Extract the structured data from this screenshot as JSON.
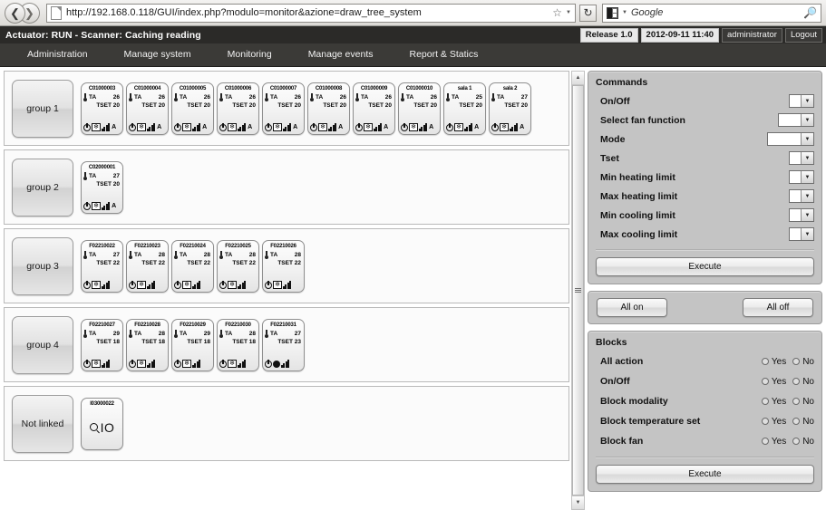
{
  "browser": {
    "back_icon": "arrow-left-icon",
    "forward_icon": "arrow-right-icon",
    "url": "http://192.168.0.118/GUI/index.php?modulo=monitor&azione=draw_tree_system",
    "bookmark_icon": "star-icon",
    "reload_icon": "reload-icon",
    "search_engine": "Google",
    "search_icon": "magnifier-icon"
  },
  "app_header": {
    "status": "Actuator: RUN - Scanner: Caching reading",
    "release": "Release 1.0",
    "datetime": "2012-09-11 11:40",
    "user": "administrator",
    "logout": "Logout"
  },
  "nav": {
    "items": [
      {
        "label": "Administration"
      },
      {
        "label": "Manage system"
      },
      {
        "label": "Monitoring"
      },
      {
        "label": "Manage events"
      },
      {
        "label": "Report & Statics"
      }
    ]
  },
  "tree": {
    "groups": [
      {
        "name": "group 1",
        "devices": [
          {
            "code": "C01000003",
            "ta_label": "TA",
            "ta": "26",
            "tset_label": "TSET",
            "tset": "20",
            "mode_icon": "snowflake-box-icon",
            "fan": "A"
          },
          {
            "code": "C01000004",
            "ta_label": "TA",
            "ta": "26",
            "tset_label": "TSET",
            "tset": "20",
            "mode_icon": "snowflake-box-icon",
            "fan": "A"
          },
          {
            "code": "C01000005",
            "ta_label": "TA",
            "ta": "26",
            "tset_label": "TSET",
            "tset": "20",
            "mode_icon": "snowflake-box-icon",
            "fan": "A"
          },
          {
            "code": "C01000006",
            "ta_label": "TA",
            "ta": "26",
            "tset_label": "TSET",
            "tset": "20",
            "mode_icon": "snowflake-box-icon",
            "fan": "A"
          },
          {
            "code": "C01000007",
            "ta_label": "TA",
            "ta": "26",
            "tset_label": "TSET",
            "tset": "20",
            "mode_icon": "snowflake-box-icon",
            "fan": "A"
          },
          {
            "code": "C01000008",
            "ta_label": "TA",
            "ta": "26",
            "tset_label": "TSET",
            "tset": "20",
            "mode_icon": "snowflake-box-icon",
            "fan": "A"
          },
          {
            "code": "C01000009",
            "ta_label": "TA",
            "ta": "26",
            "tset_label": "TSET",
            "tset": "20",
            "mode_icon": "snowflake-box-icon",
            "fan": "A"
          },
          {
            "code": "C01000010",
            "ta_label": "TA",
            "ta": "26",
            "tset_label": "TSET",
            "tset": "20",
            "mode_icon": "snowflake-box-icon",
            "fan": "A"
          },
          {
            "code": "sala 1",
            "ta_label": "TA",
            "ta": "25",
            "tset_label": "TSET",
            "tset": "20",
            "mode_icon": "snowflake-box-icon",
            "fan": "A"
          },
          {
            "code": "sala 2",
            "ta_label": "TA",
            "ta": "27",
            "tset_label": "TSET",
            "tset": "20",
            "mode_icon": "snowflake-box-icon",
            "fan": "A"
          }
        ]
      },
      {
        "name": "group 2",
        "devices": [
          {
            "code": "C02000001",
            "ta_label": "TA",
            "ta": "27",
            "tset_label": "TSET",
            "tset": "20",
            "mode_icon": "snowflake-box-icon",
            "fan": "A"
          }
        ]
      },
      {
        "name": "group 3",
        "devices": [
          {
            "code": "F02210022",
            "ta_label": "TA",
            "ta": "27",
            "tset_label": "TSET",
            "tset": "22",
            "mode_icon": "snowflake-box-icon",
            "fan": ""
          },
          {
            "code": "F02210023",
            "ta_label": "TA",
            "ta": "28",
            "tset_label": "TSET",
            "tset": "22",
            "mode_icon": "snowflake-box-icon",
            "fan": ""
          },
          {
            "code": "F02210024",
            "ta_label": "TA",
            "ta": "28",
            "tset_label": "TSET",
            "tset": "22",
            "mode_icon": "snowflake-box-icon",
            "fan": ""
          },
          {
            "code": "F02210025",
            "ta_label": "TA",
            "ta": "28",
            "tset_label": "TSET",
            "tset": "22",
            "mode_icon": "snowflake-box-icon",
            "fan": ""
          },
          {
            "code": "F02210026",
            "ta_label": "TA",
            "ta": "28",
            "tset_label": "TSET",
            "tset": "22",
            "mode_icon": "snowflake-box-icon",
            "fan": ""
          }
        ]
      },
      {
        "name": "group 4",
        "devices": [
          {
            "code": "F02210027",
            "ta_label": "TA",
            "ta": "29",
            "tset_label": "TSET",
            "tset": "18",
            "mode_icon": "snowflake-box-icon",
            "fan": ""
          },
          {
            "code": "F02210028",
            "ta_label": "TA",
            "ta": "28",
            "tset_label": "TSET",
            "tset": "18",
            "mode_icon": "snowflake-box-icon",
            "fan": ""
          },
          {
            "code": "F02210029",
            "ta_label": "TA",
            "ta": "29",
            "tset_label": "TSET",
            "tset": "18",
            "mode_icon": "snowflake-box-icon",
            "fan": ""
          },
          {
            "code": "F02210030",
            "ta_label": "TA",
            "ta": "28",
            "tset_label": "TSET",
            "tset": "18",
            "mode_icon": "snowflake-box-icon",
            "fan": ""
          },
          {
            "code": "F02210031",
            "ta_label": "TA",
            "ta": "27",
            "tset_label": "TSET",
            "tset": "23",
            "mode_icon": "filled-dot-icon",
            "fan": ""
          }
        ]
      },
      {
        "name": "Not linked",
        "io_devices": [
          {
            "code": "I03000022",
            "label": "IO",
            "icon": "magnifier-icon"
          }
        ]
      }
    ]
  },
  "commands": {
    "title": "Commands",
    "rows": [
      {
        "label": "On/Off",
        "value": "",
        "width": "w-sm"
      },
      {
        "label": "Select fan function",
        "value": "",
        "width": "w-md"
      },
      {
        "label": "Mode",
        "value": "",
        "width": "w-lg"
      },
      {
        "label": "Tset",
        "value": "",
        "width": "w-sm"
      },
      {
        "label": "Min heating limit",
        "value": "",
        "width": "w-sm"
      },
      {
        "label": "Max heating limit",
        "value": "",
        "width": "w-sm"
      },
      {
        "label": "Min cooling limit",
        "value": "",
        "width": "w-sm"
      },
      {
        "label": "Max cooling limit",
        "value": "",
        "width": "w-sm"
      }
    ],
    "execute": "Execute"
  },
  "all_buttons": {
    "all_on": "All on",
    "all_off": "All off"
  },
  "blocks": {
    "title": "Blocks",
    "yes_label": "Yes",
    "no_label": "No",
    "rows": [
      {
        "label": "All action"
      },
      {
        "label": "On/Off"
      },
      {
        "label": "Block modality"
      },
      {
        "label": "Block temperature set"
      },
      {
        "label": "Block fan"
      }
    ],
    "execute": "Execute"
  }
}
